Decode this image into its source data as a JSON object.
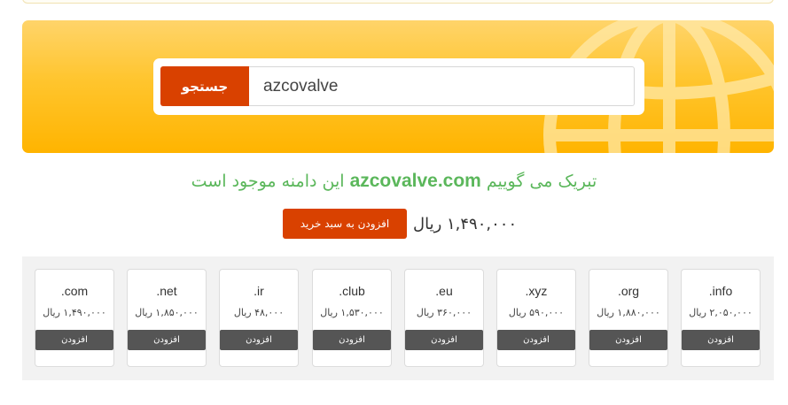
{
  "search": {
    "button_label": "جستجو",
    "value": "azcovalve"
  },
  "result": {
    "prefix": "تبریک می گوییم",
    "domain": "azcovalve.com",
    "suffix": "این دامنه موجود است",
    "price": "۱,۴۹۰,۰۰۰ ریال",
    "add_to_cart_label": "افزودن به سبد خرید"
  },
  "colors": {
    "accent": "#d94100",
    "success_text": "#5bb75b",
    "hero": "#ffc52e",
    "card_button": "#555555"
  },
  "tlds": [
    {
      "name": ".com",
      "price": "۱,۴۹۰,۰۰۰ ریال",
      "add_label": "افزودن"
    },
    {
      "name": ".net",
      "price": "۱,۸۵۰,۰۰۰ ریال",
      "add_label": "افزودن"
    },
    {
      "name": ".ir",
      "price": "۴۸,۰۰۰ ریال",
      "add_label": "افزودن"
    },
    {
      "name": ".club",
      "price": "۱,۵۳۰,۰۰۰ ریال",
      "add_label": "افزودن"
    },
    {
      "name": ".eu",
      "price": "۳۶۰,۰۰۰ ریال",
      "add_label": "افزودن"
    },
    {
      "name": ".xyz",
      "price": "۵۹۰,۰۰۰ ریال",
      "add_label": "افزودن"
    },
    {
      "name": ".org",
      "price": "۱,۸۸۰,۰۰۰ ریال",
      "add_label": "افزودن"
    },
    {
      "name": ".info",
      "price": "۲,۰۵۰,۰۰۰ ریال",
      "add_label": "افزودن"
    }
  ],
  "icons": {
    "hero_decoration": "globe-icon"
  }
}
